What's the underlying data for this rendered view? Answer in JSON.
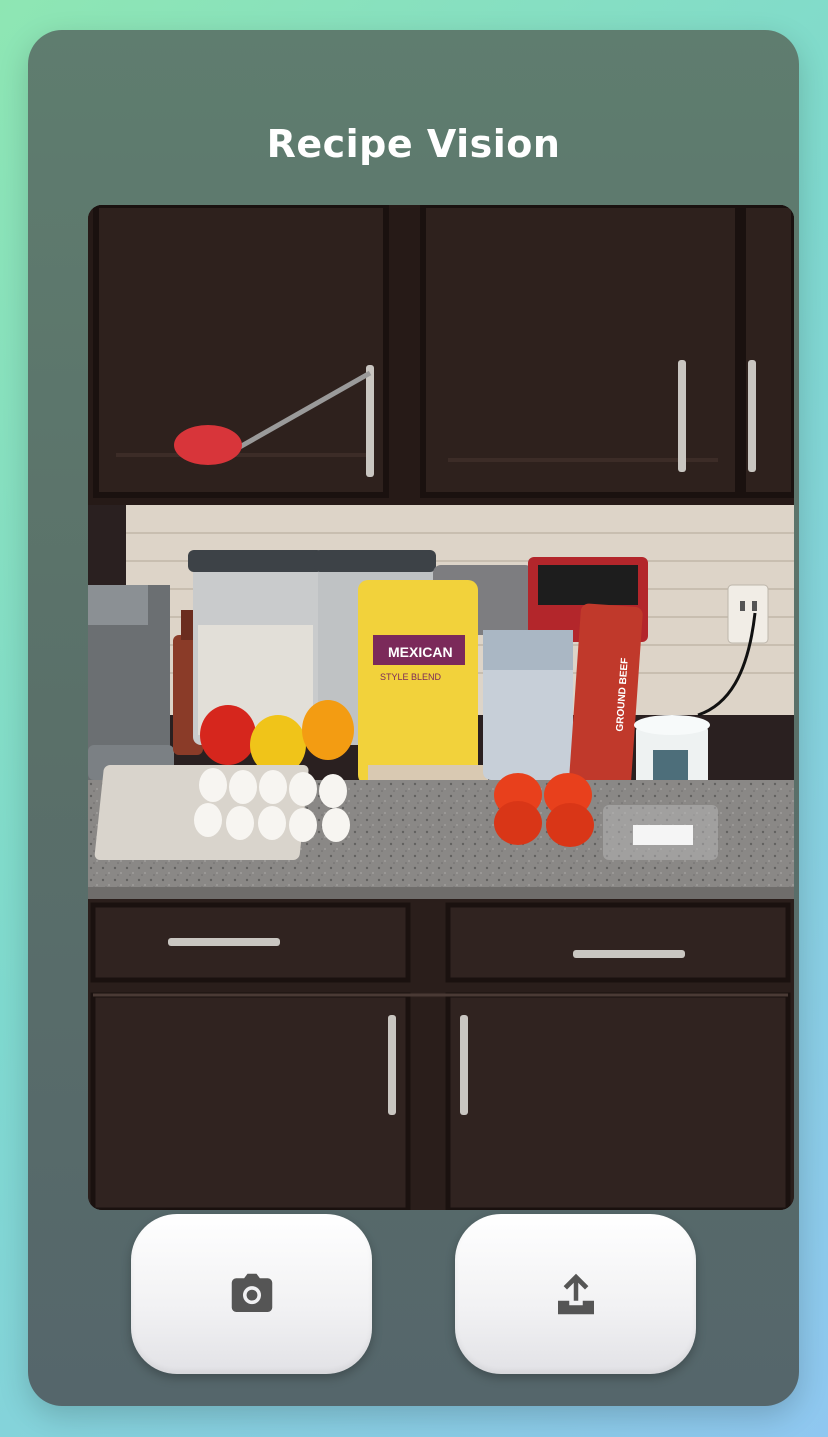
{
  "app": {
    "title": "Recipe Vision"
  },
  "photo": {
    "package_texts": {
      "cheese_brand": "MEXICAN",
      "cheese_sub": "STYLE BLEND",
      "beef_label": "GROUND BEEF"
    }
  },
  "actions": {
    "camera": {
      "icon": "camera-icon"
    },
    "upload": {
      "icon": "upload-icon"
    }
  },
  "colors": {
    "card": "#5a7069",
    "title": "#ffffff",
    "button": "#f4f4f6",
    "icon": "#555555"
  }
}
